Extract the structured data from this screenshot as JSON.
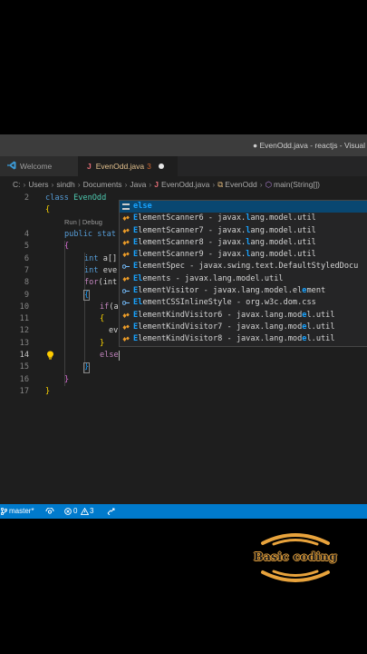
{
  "window": {
    "title": "● EvenOdd.java - reactjs - Visual"
  },
  "tabs": [
    {
      "label": "Welcome"
    },
    {
      "label": "EvenOdd.java",
      "problems": "3"
    }
  ],
  "breadcrumb": {
    "items": [
      "C:",
      "Users",
      "sindh",
      "Documents",
      "Java",
      "EvenOdd.java",
      "EvenOdd",
      "main(String[])"
    ],
    "java_icon": "J"
  },
  "editor": {
    "line_numbers": [
      "2",
      "",
      "4",
      "5",
      "6",
      "7",
      "8",
      "9",
      "10",
      "11",
      "12",
      "13",
      "14",
      "15",
      "16",
      "17"
    ],
    "codelens": "Run | Debug",
    "lines": {
      "l2_kw": "class",
      "l2_name": "EvenOdd",
      "l3": "{",
      "l4_kw": "public stat",
      "l5": "{",
      "l6_kw": "int",
      "l6_rest": " a[]",
      "l7_kw": "int",
      "l7_rest": " eve",
      "l8_kw": "for",
      "l8_rest": "(int",
      "l9": "{",
      "l10_kw": "if",
      "l10_rest": "(a",
      "l11": "{",
      "l12": "ev",
      "l13": "}",
      "l14": "else",
      "l15": "}",
      "l16": "}",
      "l17": "}"
    }
  },
  "suggestions": [
    {
      "pre": "",
      "hl": "else",
      "post": "",
      "icon": "keyword-icon",
      "selected": true
    },
    {
      "pre": "",
      "hl": "E",
      "mid": "lementScanner6 - javax.",
      "hl2": "l",
      "post": "ang.model.util",
      "icon": "class-icon"
    },
    {
      "pre": "",
      "hl": "E",
      "mid": "lementScanner7 - javax.",
      "hl2": "l",
      "post": "ang.model.util",
      "icon": "class-icon"
    },
    {
      "pre": "",
      "hl": "E",
      "mid": "lementScanner8 - javax.",
      "hl2": "l",
      "post": "ang.model.util",
      "icon": "class-icon"
    },
    {
      "pre": "",
      "hl": "E",
      "mid": "lementScanner9 - javax.",
      "hl2": "l",
      "post": "ang.model.util",
      "icon": "class-icon"
    },
    {
      "pre": "",
      "hl": "E",
      "mid": "lementSpec - javax.swing.text.DefaultStyledDocu",
      "hl2": "",
      "post": "",
      "icon": "interface-icon"
    },
    {
      "pre": "",
      "hl": "El",
      "mid": "ements - javax.lang.model.util",
      "hl2": "",
      "post": "",
      "icon": "class-icon"
    },
    {
      "pre": "",
      "hl": "E",
      "mid": "lementVisitor - javax.lang.model.el",
      "hl2": "e",
      "post": "ment",
      "icon": "interface-icon"
    },
    {
      "pre": "",
      "hl": "El",
      "mid": "ementCSSInlineStyle - org.w3c.dom.css",
      "hl2": "",
      "post": "",
      "icon": "interface-icon"
    },
    {
      "pre": "",
      "hl": "E",
      "mid": "lementKindVisitor6 - javax.lang.mod",
      "hl2": "e",
      "post": "l.util",
      "icon": "class-icon"
    },
    {
      "pre": "",
      "hl": "E",
      "mid": "lementKindVisitor7 - javax.lang.mod",
      "hl2": "e",
      "post": "l.util",
      "icon": "class-icon"
    },
    {
      "pre": "",
      "hl": "E",
      "mid": "lementKindVisitor8 - javax.lang.mod",
      "hl2": "e",
      "post": "l.util",
      "icon": "class-icon"
    }
  ],
  "statusbar": {
    "branch": "master*",
    "errors": "0",
    "warnings": "3"
  },
  "logo": {
    "text": "Basic coding"
  },
  "colors": {
    "accent": "#007acc",
    "selection": "#094771",
    "match_highlight": "#18a3ff",
    "logo_orange": "#e8a33c"
  }
}
